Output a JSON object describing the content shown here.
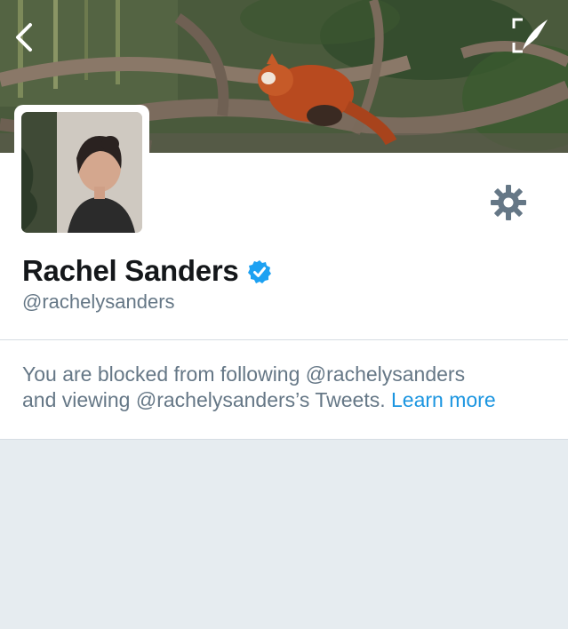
{
  "header": {
    "back_icon": "chevron-left-icon",
    "compose_icon": "compose-quill-icon"
  },
  "profile": {
    "display_name": "Rachel Sanders",
    "handle": "@rachelysanders",
    "verified_icon": "verified-badge-icon",
    "settings_icon": "gear-icon",
    "verified_color": "#1da1f2"
  },
  "blocked_notice": {
    "line1": "You are blocked from following @rachelysanders",
    "line2": "and viewing @rachelysanders’s Tweets.",
    "learn_more": "Learn more"
  },
  "colors": {
    "background": "#e6ecf0",
    "link": "#1b95e0",
    "secondary_text": "#657786"
  }
}
